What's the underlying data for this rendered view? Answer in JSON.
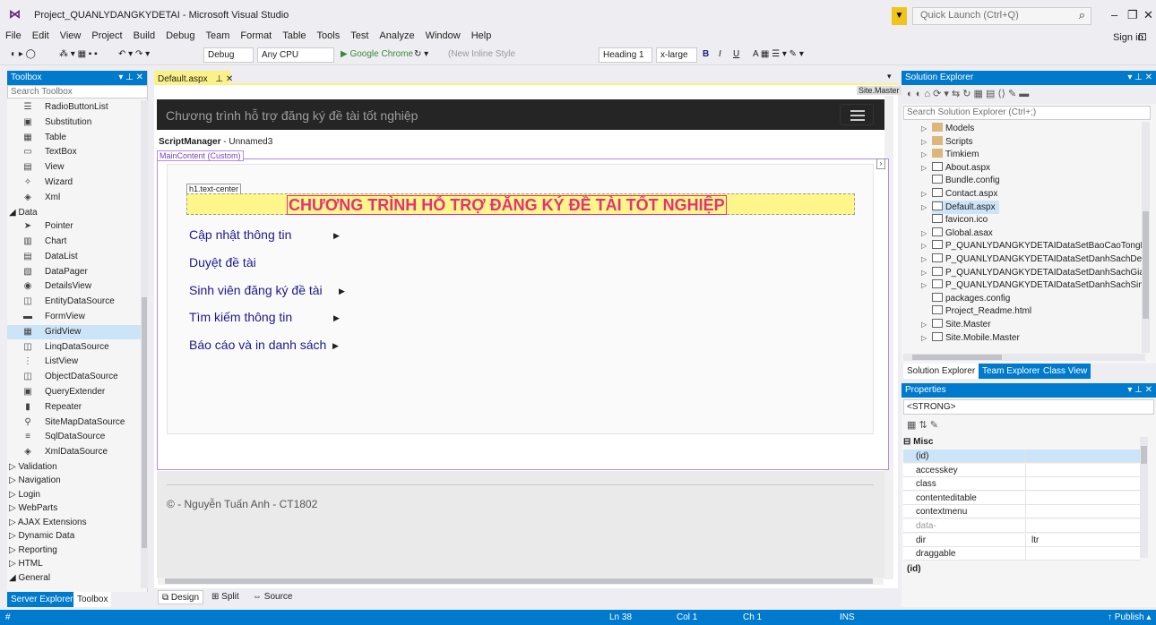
{
  "window": {
    "title": "Project_QUANLYDANGKYDETAI - Microsoft Visual Studio",
    "quick_launch": "Quick Launch (Ctrl+Q)",
    "sign_in": "Sign in"
  },
  "menu": [
    "File",
    "Edit",
    "View",
    "Project",
    "Build",
    "Debug",
    "Team",
    "Format",
    "Table",
    "Tools",
    "Test",
    "Analyze",
    "Window",
    "Help"
  ],
  "toolbar": {
    "config": "Debug",
    "platform": "Any CPU",
    "run": "▶ Google Chrome",
    "style": "(New Inline Style",
    "block": "Heading 1",
    "size": "x-large",
    "bold": "B",
    "italic": "I",
    "underline": "U"
  },
  "toolbox": {
    "title": "Toolbox",
    "search": "Search Toolbox",
    "items_top": [
      {
        "label": "RadioButtonList",
        "icon": "list-icon"
      },
      {
        "label": "Substitution",
        "icon": "substitution-icon"
      },
      {
        "label": "Table",
        "icon": "table-icon"
      },
      {
        "label": "TextBox",
        "icon": "textbox-icon"
      },
      {
        "label": "View",
        "icon": "view-icon"
      },
      {
        "label": "Wizard",
        "icon": "wizard-icon"
      },
      {
        "label": "Xml",
        "icon": "xml-icon"
      }
    ],
    "data_section": "◢ Data",
    "data_items": [
      {
        "label": "Pointer",
        "icon": "pointer-icon"
      },
      {
        "label": "Chart",
        "icon": "chart-icon"
      },
      {
        "label": "DataList",
        "icon": "datalist-icon"
      },
      {
        "label": "DataPager",
        "icon": "datapager-icon"
      },
      {
        "label": "DetailsView",
        "icon": "detailsview-icon"
      },
      {
        "label": "EntityDataSource",
        "icon": "datasource-icon"
      },
      {
        "label": "FormView",
        "icon": "formview-icon"
      },
      {
        "label": "GridView",
        "icon": "gridview-icon"
      },
      {
        "label": "LinqDataSource",
        "icon": "datasource-icon"
      },
      {
        "label": "ListView",
        "icon": "listview-icon"
      },
      {
        "label": "ObjectDataSource",
        "icon": "datasource-icon"
      },
      {
        "label": "QueryExtender",
        "icon": "query-icon"
      },
      {
        "label": "Repeater",
        "icon": "repeater-icon"
      },
      {
        "label": "SiteMapDataSource",
        "icon": "sitemap-icon"
      },
      {
        "label": "SqlDataSource",
        "icon": "sql-icon"
      },
      {
        "label": "XmlDataSource",
        "icon": "xml-icon"
      }
    ],
    "sections": [
      "▷ Validation",
      "▷ Navigation",
      "▷ Login",
      "▷ WebParts",
      "▷ AJAX Extensions",
      "▷ Dynamic Data",
      "▷ Reporting",
      "▷ HTML",
      "◢ General"
    ],
    "bottom_tabs": [
      "Server Explorer",
      "Toolbox"
    ]
  },
  "editor": {
    "tab": "Default.aspx",
    "site_master": "Site.Master",
    "nav_title": "Chương trình hỗ trợ đăng ký đề tài tốt nghiệp",
    "script_manager_bold": "ScriptManager",
    "script_manager_rest": " - Unnamed3",
    "main_content": "MainContent (Custom)",
    "h1_tag": "h1.text-center",
    "h1": "CHƯƠNG TRÌNH HỖ TRỢ ĐĂNG KÝ ĐỀ TÀI TỐT NGHIỆP",
    "menu_items": [
      "Cập nhật thông tin",
      "Duyệt đề tài",
      "Sinh viên đăng ký đề tài",
      "Tìm kiếm thông tin",
      "Báo cáo và in danh sách"
    ],
    "footer": "© - Nguyễn Tuấn Anh - CT1802",
    "view_tabs": [
      "Design",
      "Split",
      "Source"
    ]
  },
  "solution_explorer": {
    "title": "Solution Explorer",
    "search": "Search Solution Explorer (Ctrl+;)",
    "items": [
      {
        "label": "Models",
        "type": "folder",
        "expand": "▷"
      },
      {
        "label": "Scripts",
        "type": "folder",
        "expand": "▷"
      },
      {
        "label": "Timkiem",
        "type": "folder",
        "expand": "▷"
      },
      {
        "label": "About.aspx",
        "type": "file",
        "expand": "▷"
      },
      {
        "label": "Bundle.config",
        "type": "file",
        "expand": ""
      },
      {
        "label": "Contact.aspx",
        "type": "file",
        "expand": "▷"
      },
      {
        "label": "Default.aspx",
        "type": "file",
        "expand": "▷"
      },
      {
        "label": "favicon.ico",
        "type": "file",
        "expand": ""
      },
      {
        "label": "Global.asax",
        "type": "file",
        "expand": "▷"
      },
      {
        "label": "P_QUANLYDANGKYDETAIDataSetBaoCaoTongHo",
        "type": "file",
        "expand": "▷"
      },
      {
        "label": "P_QUANLYDANGKYDETAIDataSetDanhSachDeTai.",
        "type": "file",
        "expand": "▷"
      },
      {
        "label": "P_QUANLYDANGKYDETAIDataSetDanhSachGiang",
        "type": "file",
        "expand": "▷"
      },
      {
        "label": "P_QUANLYDANGKYDETAIDataSetDanhSachSinhV",
        "type": "file",
        "expand": "▷"
      },
      {
        "label": "packages.config",
        "type": "file",
        "expand": ""
      },
      {
        "label": "Project_Readme.html",
        "type": "file",
        "expand": ""
      },
      {
        "label": "Site.Master",
        "type": "file",
        "expand": "▷"
      },
      {
        "label": "Site.Mobile.Master",
        "type": "file",
        "expand": "▷"
      }
    ],
    "tabs": [
      "Solution Explorer",
      "Team Explorer",
      "Class View"
    ]
  },
  "properties": {
    "title": "Properties",
    "selected": "<STRONG>",
    "category": "⊟ Misc",
    "rows": [
      {
        "key": "(id)",
        "value": ""
      },
      {
        "key": "accesskey",
        "value": ""
      },
      {
        "key": "class",
        "value": ""
      },
      {
        "key": "contenteditable",
        "value": ""
      },
      {
        "key": "contextmenu",
        "value": ""
      },
      {
        "key": "data-",
        "value": ""
      },
      {
        "key": "dir",
        "value": "ltr"
      },
      {
        "key": "draggable",
        "value": ""
      }
    ],
    "description": "(id)"
  },
  "status": {
    "ln": "Ln 38",
    "col": "Col 1",
    "ch": "Ch 1",
    "ins": "INS",
    "publish": "↑ Publish ▴"
  },
  "colors": {
    "accent": "#007acc",
    "h1_text": "#e0347a",
    "h1_bg": "#fef68a",
    "navbar": "#252525"
  }
}
